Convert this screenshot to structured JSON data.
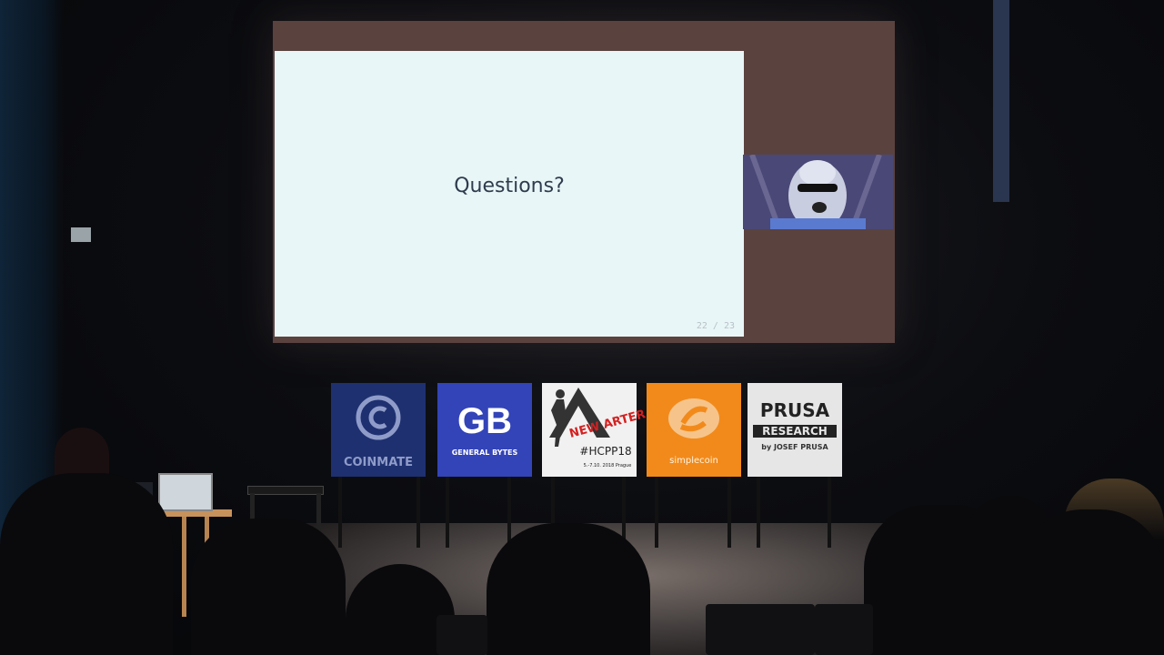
{
  "scene": {
    "slide": {
      "title": "Questions?",
      "page": "22 / 23"
    },
    "sponsors": [
      {
        "name": "COINMATE",
        "color": "#1e3070"
      },
      {
        "name": "GB",
        "sub": "GENERAL BYTES",
        "color": "#3344b8"
      },
      {
        "name": "#HCPP18",
        "sub": "NEW ARTER",
        "detail": "5.-7.10. 2018 Prague",
        "color": "#f1f1f1"
      },
      {
        "name": "simplecoin",
        "color": "#f28a1b"
      },
      {
        "name": "PRUSA",
        "sub": "RESEARCH",
        "detail": "by JOSEF PRUSA",
        "color": "#e6e6e6"
      }
    ]
  }
}
